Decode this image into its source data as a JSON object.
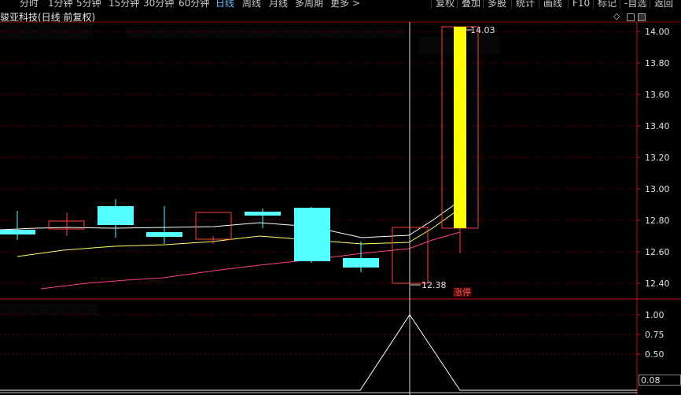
{
  "timeframes": [
    "分时",
    "1分钟",
    "5分钟",
    "15分钟",
    "30分钟",
    "60分钟",
    "日线",
    "周线",
    "月线",
    "多周期",
    "更多 >"
  ],
  "active_timeframe": "日线",
  "toolbar": [
    "复权",
    "叠加",
    "多股",
    "统计",
    "画线",
    "F10",
    "标记",
    "-自选",
    "返回"
  ],
  "title": "骏亚科技(日线 前复权)",
  "price_axis": [
    "14.00",
    "13.80",
    "13.60",
    "13.40",
    "13.20",
    "13.00",
    "12.80",
    "12.60",
    "12.40"
  ],
  "indicator_axis": [
    "1.00",
    "0.75",
    "0.50"
  ],
  "high_marker": "14.03",
  "low_marker": "12.38",
  "limit_up_tag": "涨停",
  "indicator_value": "0.08",
  "colors": {
    "up": "#ff4040",
    "down": "#54ffff",
    "limit_up": "#ffff00",
    "ma_white": "#ffffff",
    "ma_yellow": "#ffff66",
    "ma_pink": "#ff3c8c",
    "grid": "#6a0000",
    "active_tab": "#6fb8ff"
  },
  "icons": [
    "diamond-icon",
    "restore-icon",
    "close-icon"
  ]
}
